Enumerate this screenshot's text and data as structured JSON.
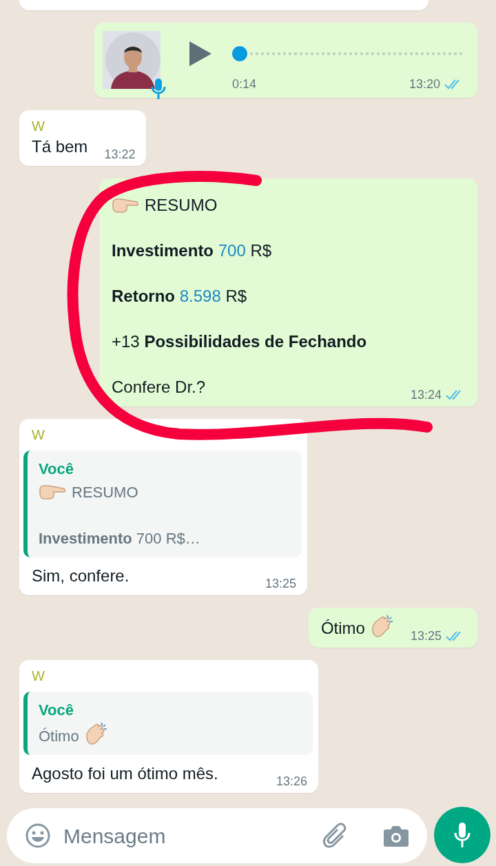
{
  "messages": [
    {
      "kind": "cut",
      "outgoing": false
    },
    {
      "kind": "voice",
      "outgoing": true,
      "level": 0,
      "duration": "0:14",
      "time": "13:20",
      "read": true
    },
    {
      "kind": "text",
      "outgoing": false,
      "sender": "W",
      "paragraphs": [
        [
          {
            "kind": "plain",
            "text": "Tá bem"
          }
        ]
      ],
      "time": "13:22"
    },
    {
      "kind": "text",
      "outgoing": true,
      "paragraphs": [
        [
          {
            "kind": "pointing-hand"
          },
          {
            "kind": "plain",
            "text": "RESUMO"
          }
        ],
        [
          {
            "kind": "bold",
            "text": "Investimento"
          },
          {
            "kind": "number",
            "text": "700"
          },
          {
            "kind": "plain",
            "text": "R$"
          }
        ],
        [
          {
            "kind": "bold",
            "text": "Retorno"
          },
          {
            "kind": "number",
            "text": "8.598"
          },
          {
            "kind": "plain",
            "text": "R$"
          }
        ],
        [
          {
            "kind": "plain",
            "text": "+13"
          },
          {
            "kind": "bold",
            "text": "Possibilidades de Fechando"
          }
        ],
        [
          {
            "kind": "plain",
            "text": "Confere Dr.?"
          }
        ]
      ],
      "time": "13:24",
      "read": true
    },
    {
      "kind": "reply",
      "outgoing": false,
      "sender": "W",
      "quote": {
        "author": "Você",
        "lines": [
          [
            {
              "kind": "pointing-hand"
            },
            {
              "kind": "plain",
              "text": "RESUMO"
            }
          ],
          [
            {
              "kind": "bold",
              "text": "Investimento"
            },
            {
              "kind": "plain",
              "text": "700 R$…"
            }
          ]
        ]
      },
      "paragraphs": [
        [
          {
            "kind": "plain",
            "text": "Sim, confere."
          }
        ]
      ],
      "time": "13:25"
    },
    {
      "kind": "text",
      "outgoing": true,
      "paragraphs": [
        [
          {
            "kind": "plain",
            "text": "Ótimo"
          },
          {
            "kind": "clapping-hands"
          }
        ]
      ],
      "time": "13:25",
      "read": true
    },
    {
      "kind": "reply",
      "outgoing": false,
      "sender": "W",
      "quote": {
        "author": "Você",
        "lines": [
          [
            {
              "kind": "plain",
              "text": "Ótimo"
            },
            {
              "kind": "clapping-hands"
            }
          ]
        ]
      },
      "paragraphs": [
        [
          {
            "kind": "plain",
            "text": "Agosto foi um ótimo mês."
          }
        ]
      ],
      "time": "13:26"
    }
  ],
  "composer": {
    "placeholder": "Mensagem"
  }
}
